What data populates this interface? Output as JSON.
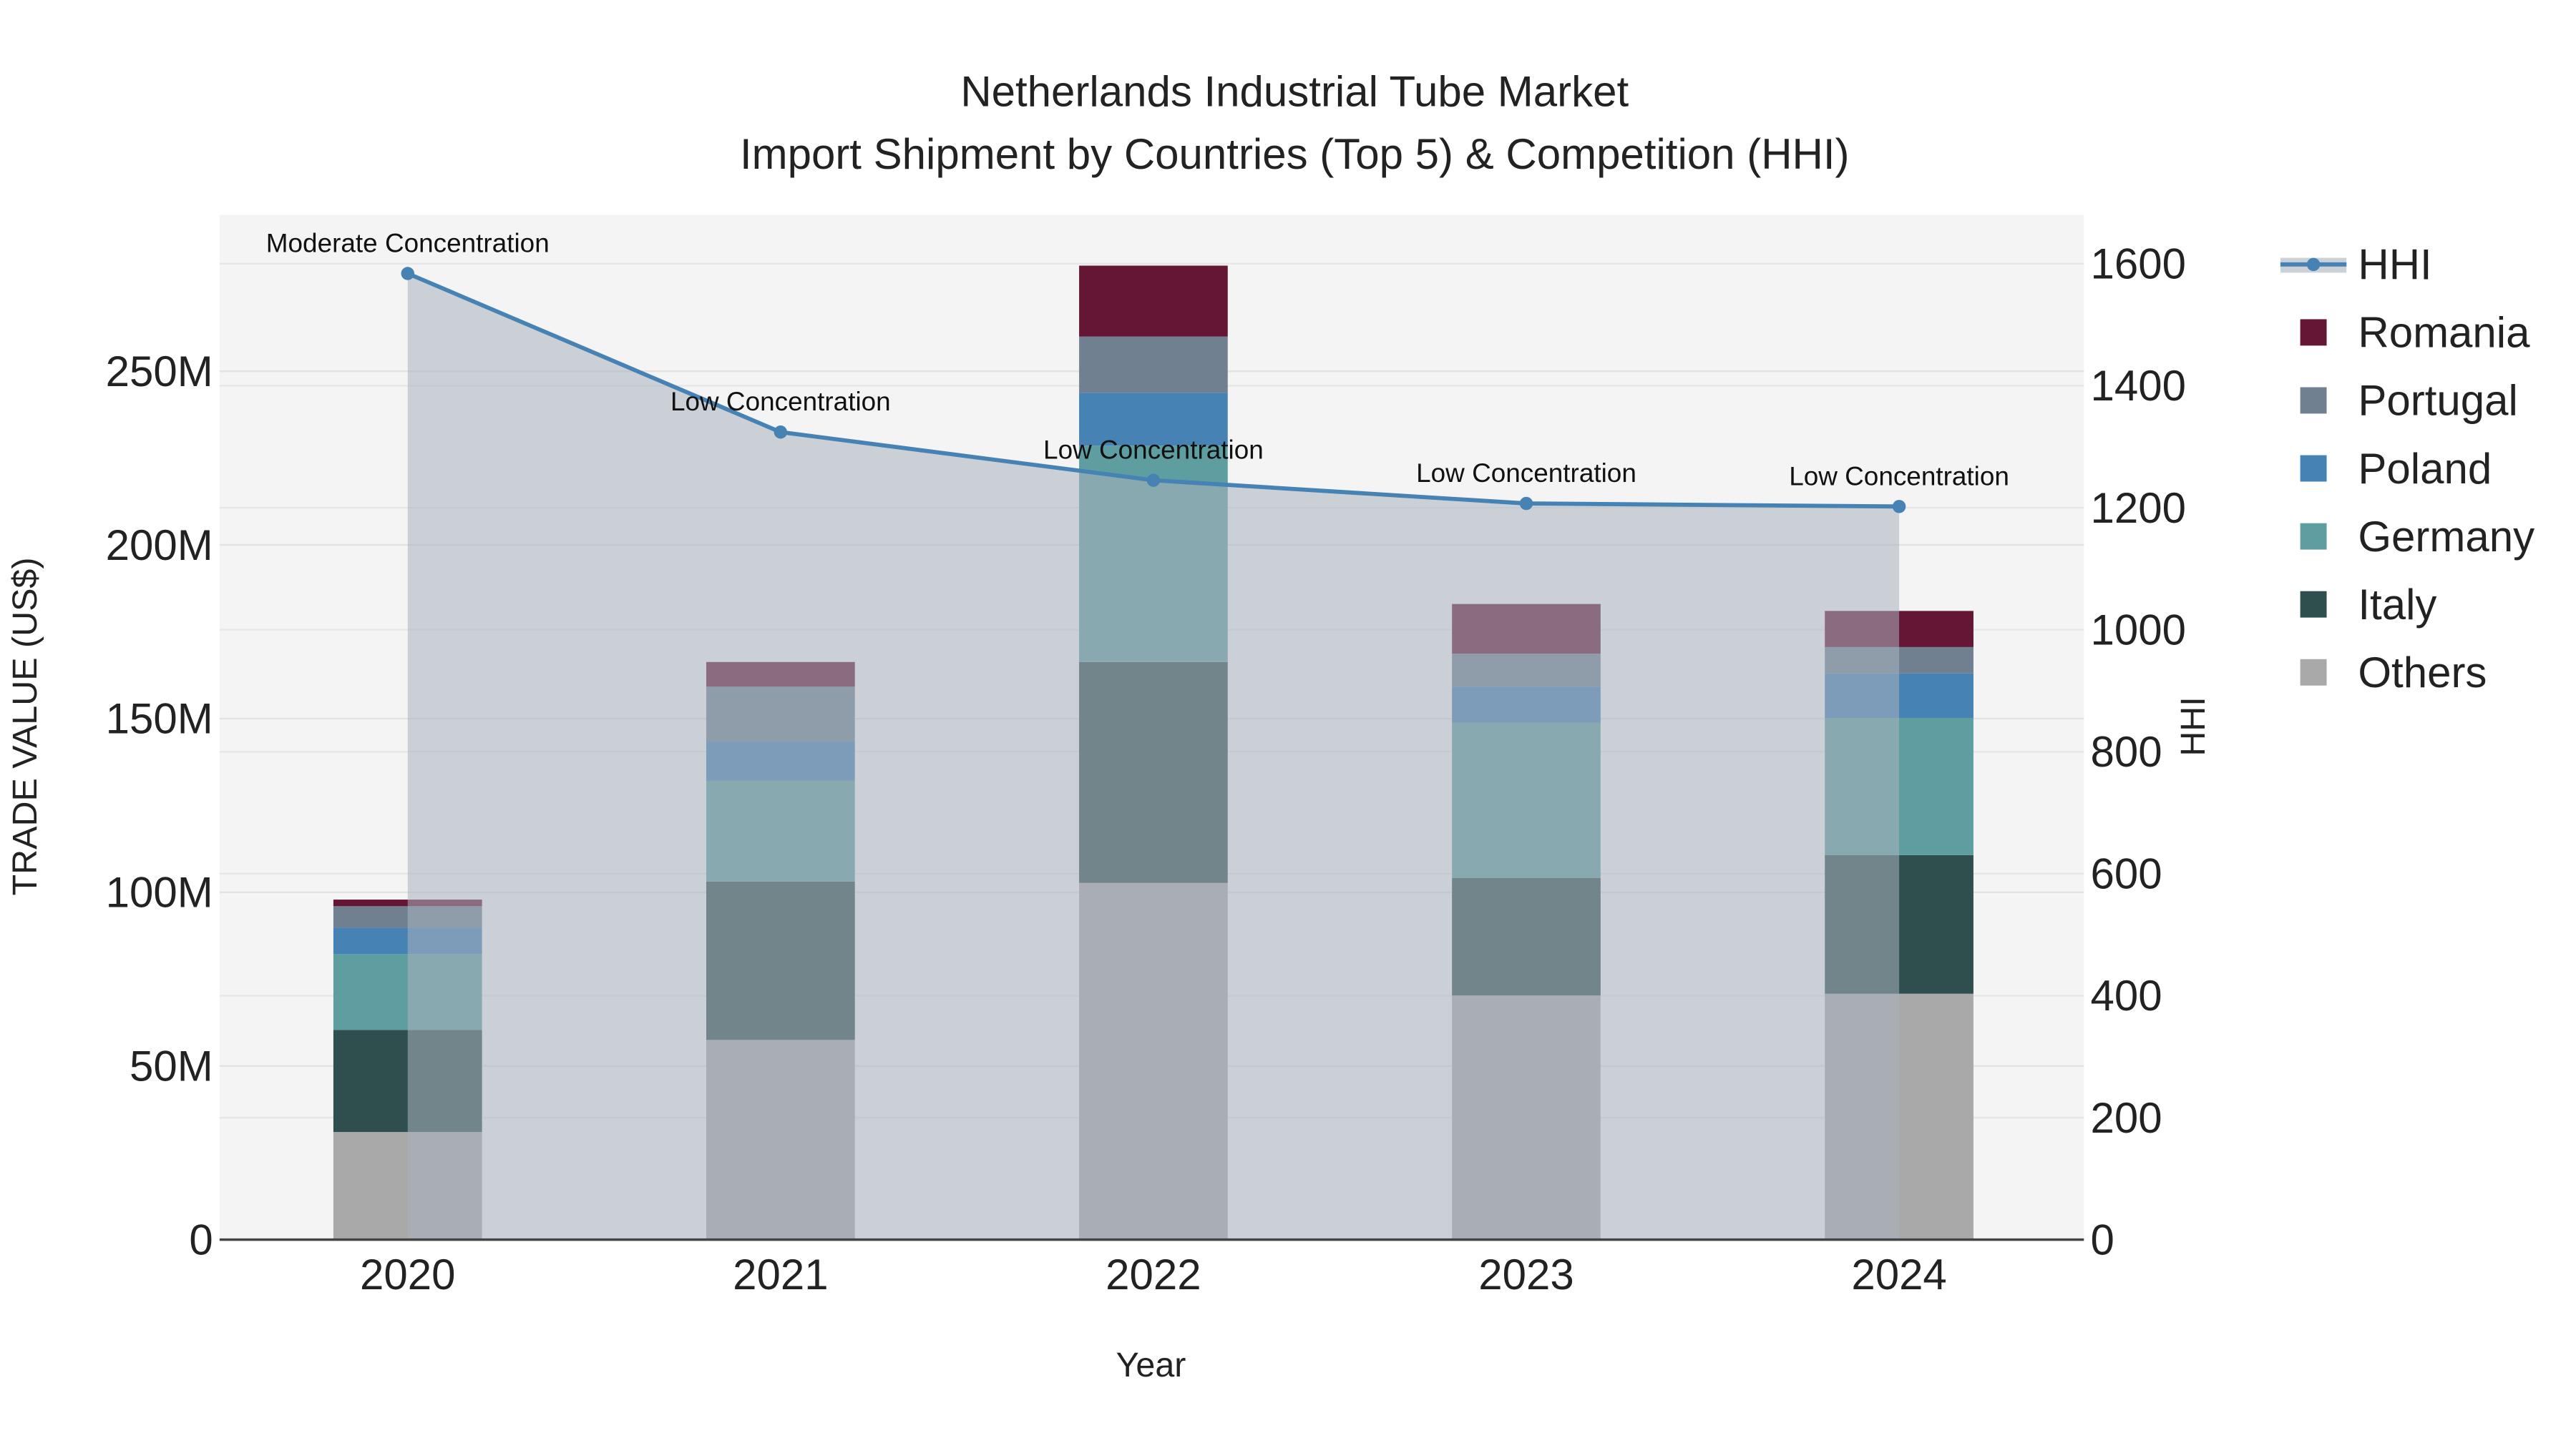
{
  "chart_data": {
    "type": "bar",
    "stacked": true,
    "title": "Netherlands Industrial Tube Market",
    "subtitle": "Import Shipment by Countries (Top 5) & Competition (HHI)",
    "xlabel": "Year",
    "ylabel": "TRADE VALUE (US$)",
    "y2label": "HHI",
    "categories": [
      "2020",
      "2021",
      "2022",
      "2023",
      "2024"
    ],
    "ylim": [
      0,
      295000000
    ],
    "y2lim": [
      0,
      1680
    ],
    "yticks": [
      {
        "v": 0,
        "label": "0"
      },
      {
        "v": 50000000,
        "label": "50M"
      },
      {
        "v": 100000000,
        "label": "100M"
      },
      {
        "v": 150000000,
        "label": "150M"
      },
      {
        "v": 200000000,
        "label": "200M"
      },
      {
        "v": 250000000,
        "label": "250M"
      }
    ],
    "y2ticks": [
      {
        "v": 0,
        "label": "0"
      },
      {
        "v": 200,
        "label": "200"
      },
      {
        "v": 400,
        "label": "400"
      },
      {
        "v": 600,
        "label": "600"
      },
      {
        "v": 800,
        "label": "800"
      },
      {
        "v": 1000,
        "label": "1000"
      },
      {
        "v": 1200,
        "label": "1200"
      },
      {
        "v": 1400,
        "label": "1400"
      },
      {
        "v": 1600,
        "label": "1600"
      }
    ],
    "series": [
      {
        "name": "Others",
        "color": "#A9A9A9",
        "values": [
          31000000,
          57500000,
          102700000,
          70300000,
          70800000
        ]
      },
      {
        "name": "Italy",
        "color": "#2F4F4F",
        "values": [
          29400000,
          45600000,
          63600000,
          33800000,
          39900000
        ]
      },
      {
        "name": "Germany",
        "color": "#5F9EA0",
        "values": [
          21800000,
          29000000,
          62300000,
          44700000,
          39500000
        ]
      },
      {
        "name": "Poland",
        "color": "#4682B4",
        "values": [
          7600000,
          11400000,
          15200000,
          10400000,
          12800000
        ]
      },
      {
        "name": "Portugal",
        "color": "#708090",
        "values": [
          6200000,
          15700000,
          16200000,
          9500000,
          7600000
        ]
      },
      {
        "name": "Romania",
        "color": "#641634",
        "values": [
          1900000,
          7100000,
          20400000,
          14300000,
          10400000
        ]
      }
    ],
    "hhi": {
      "name": "HHI",
      "color": "#4682B4",
      "values": [
        1584,
        1324,
        1245,
        1207,
        1202
      ],
      "annotations": [
        "Moderate Concentration",
        "Low Concentration",
        "Low Concentration",
        "Low Concentration",
        "Low Concentration"
      ]
    },
    "legend": {
      "placement": "right",
      "order": [
        "HHI",
        "Romania",
        "Portugal",
        "Poland",
        "Germany",
        "Italy",
        "Others"
      ]
    },
    "grid": true
  }
}
